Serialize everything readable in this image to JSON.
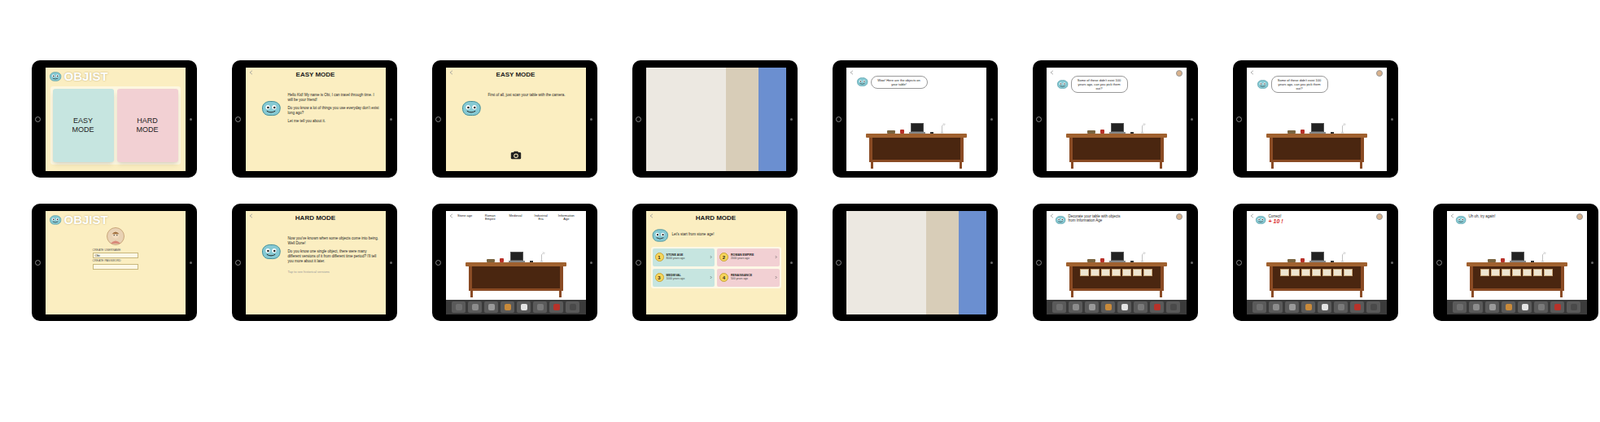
{
  "rows": [
    {
      "screens": [
        {
          "kind": "title",
          "logo": "OBJIST",
          "buttons": [
            {
              "label": "EASY MODE",
              "color": "#c6e5e0"
            },
            {
              "label": "HARD MODE",
              "color": "#f2d0d3"
            }
          ]
        },
        {
          "kind": "intro",
          "heading": "EASY MODE",
          "lines": [
            "Hello Kid! My name is Obi, I can travel through time. I will be your friend!",
            "Do you know a lot of things you use everyday don't exist long ago?",
            "Let me tell you about it."
          ]
        },
        {
          "kind": "scan",
          "heading": "EASY MODE",
          "lines": [
            "First of all, just scan your table with the camera."
          ]
        },
        {
          "kind": "photo"
        },
        {
          "kind": "desk",
          "bubble": "Wow! Here are the objects on your table!",
          "avatar": false,
          "toolbar": false,
          "shelf": false
        },
        {
          "kind": "desk",
          "bubble": "Some of these didn't exist 100 years ago, can you pick them out?",
          "avatar": true,
          "toolbar": false,
          "shelf": false
        },
        {
          "kind": "desk",
          "bubble": "Some of these didn't exist 100 years ago, can you pick them out?",
          "avatar": true,
          "toolbar": false,
          "shelf": false
        }
      ]
    },
    {
      "screens": [
        {
          "kind": "login",
          "logo": "OBJIST",
          "fields": [
            {
              "label": "CREATE USERNAME",
              "value": "Obi"
            },
            {
              "label": "CREATE PASSWORD",
              "value": ""
            }
          ]
        },
        {
          "kind": "intro",
          "heading": "HARD MODE",
          "lines": [
            "Now you've known when some objects come into being. Well Done!",
            "Do you know one single object, there were many different versions of it from different time period? I'll tell you more about it later."
          ],
          "hint": "Tap to see historical versions"
        },
        {
          "kind": "desk",
          "eras": [
            "Stone age",
            "Roman Empire",
            "Medieval",
            "Industrial Era",
            "Information Age"
          ],
          "avatar": false,
          "toolbar": true,
          "shelf": false
        },
        {
          "kind": "eras",
          "heading": "HARD MODE",
          "prompt": "Let's start from stone age!",
          "cards": [
            {
              "number": "1",
              "name": "STONE AGE",
              "sub": "8000 years ago",
              "color": "#c6e5e0"
            },
            {
              "number": "2",
              "name": "ROMAN EMPIRE",
              "sub": "2000 years ago",
              "color": "#f2d0d3"
            },
            {
              "number": "3",
              "name": "MEDIEVAL",
              "sub": "1000 years ago",
              "color": "#c6e5e0"
            },
            {
              "number": "4",
              "name": "RENAISSANCE",
              "sub": "500 years ago",
              "color": "#f2d0d3"
            }
          ]
        },
        {
          "kind": "photo"
        },
        {
          "kind": "desk",
          "prompt": "Decorate your table with objects from Information Age",
          "avatar": true,
          "toolbar": true,
          "shelf": true
        },
        {
          "kind": "desk",
          "prompt": "Correct!",
          "score": "+ 10 !",
          "avatar": true,
          "toolbar": true,
          "shelf": true
        },
        {
          "kind": "desk",
          "prompt": "Uh oh, try again!",
          "avatar": true,
          "toolbar": true,
          "shelf": true
        }
      ]
    }
  ]
}
